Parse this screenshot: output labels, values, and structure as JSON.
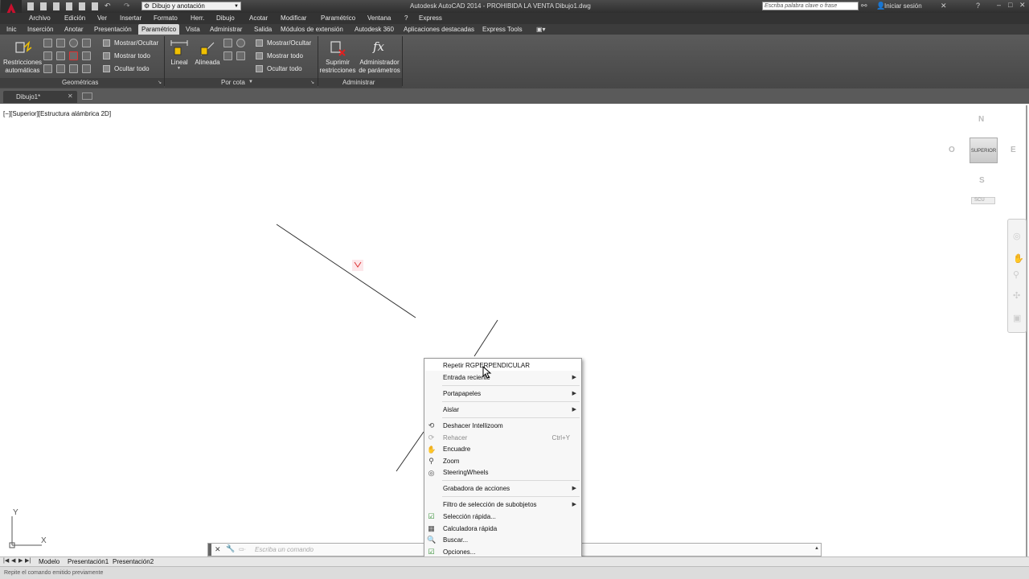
{
  "titlebar": {
    "title": "Autodesk AutoCAD 2014 - PROHIBIDA LA VENTA   Dibujo1.dwg",
    "workspace": "Dibujo y anotación",
    "search_placeholder": "Escriba palabra clave o frase",
    "signin": "Iniciar sesión"
  },
  "menubar": [
    "Archivo",
    "Edición",
    "Ver",
    "Insertar",
    "Formato",
    "Herr.",
    "Dibujo",
    "Acotar",
    "Modificar",
    "Paramétrico",
    "Ventana",
    "?",
    "Express"
  ],
  "ribbon_tabs": [
    "Inic",
    "Inserción",
    "Anotar",
    "Presentación",
    "Paramétrico",
    "Vista",
    "Administrar",
    "Salida",
    "Módulos de extensión",
    "Autodesk 360",
    "Aplicaciones destacadas",
    "Express Tools"
  ],
  "ribbon": {
    "geo": {
      "auto_label_1": "Restricciones",
      "auto_label_2": "automáticas",
      "show_hide": "Mostrar/Ocultar",
      "show_all": "Mostrar todo",
      "hide_all": "Ocultar todo",
      "panel": "Geométricas"
    },
    "dim": {
      "linear": "Lineal",
      "aligned": "Alineada",
      "show_hide": "Mostrar/Ocultar",
      "show_all": "Mostrar todo",
      "hide_all": "Ocultar todo",
      "panel": "Por cota"
    },
    "admin": {
      "delete_1": "Suprimir",
      "delete_2": "restricciones",
      "params_1": "Administrador",
      "params_2": "de parámetros",
      "fx": "fx",
      "panel": "Administrar"
    }
  },
  "doc_tab": "Dibujo1*",
  "viewport_label": "[−][Superior][Estructura alámbrica 2D]",
  "viewcube": {
    "face": "SUPERIOR",
    "n": "N",
    "s": "S",
    "e": "E",
    "w": "O",
    "ucs": "SCU"
  },
  "ucs_icon": {
    "x": "X",
    "y": "Y"
  },
  "context_menu": {
    "items": [
      {
        "label": "Repetir RGPERPENDICULAR",
        "shortcut": "",
        "submenu": false,
        "disabled": false,
        "icon": ""
      },
      {
        "label": "Entrada reciente",
        "shortcut": "",
        "submenu": true,
        "disabled": false,
        "icon": ""
      },
      {
        "label": "Portapapeles",
        "shortcut": "",
        "submenu": true,
        "disabled": false,
        "icon": ""
      },
      {
        "label": "Aislar",
        "shortcut": "",
        "submenu": true,
        "disabled": false,
        "icon": ""
      },
      {
        "label": "Deshacer Intellizoom",
        "shortcut": "",
        "submenu": false,
        "disabled": false,
        "icon": "undo-icon"
      },
      {
        "label": "Rehacer",
        "shortcut": "Ctrl+Y",
        "submenu": false,
        "disabled": true,
        "icon": "redo-icon"
      },
      {
        "label": "Encuadre",
        "shortcut": "",
        "submenu": false,
        "disabled": false,
        "icon": "pan-icon"
      },
      {
        "label": "Zoom",
        "shortcut": "",
        "submenu": false,
        "disabled": false,
        "icon": "zoom-icon"
      },
      {
        "label": "SteeringWheels",
        "shortcut": "",
        "submenu": false,
        "disabled": false,
        "icon": "steeringwheel-icon"
      },
      {
        "label": "Grabadora de acciones",
        "shortcut": "",
        "submenu": true,
        "disabled": false,
        "icon": ""
      },
      {
        "label": "Filtro de selección de subobjetos",
        "shortcut": "",
        "submenu": true,
        "disabled": false,
        "icon": ""
      },
      {
        "label": "Selección rápida...",
        "shortcut": "",
        "submenu": false,
        "disabled": false,
        "icon": "quickselect-icon"
      },
      {
        "label": "Calculadora rápida",
        "shortcut": "",
        "submenu": false,
        "disabled": false,
        "icon": "calculator-icon"
      },
      {
        "label": "Buscar...",
        "shortcut": "",
        "submenu": false,
        "disabled": false,
        "icon": "find-icon"
      },
      {
        "label": "Opciones...",
        "shortcut": "",
        "submenu": false,
        "disabled": false,
        "icon": "options-icon"
      }
    ]
  },
  "command_line": {
    "placeholder": "Escriba un comando"
  },
  "layout_tabs": [
    "Modelo",
    "Presentación1",
    "Presentación2"
  ],
  "status_text": "Repite el comando emitido previamente",
  "colors": {
    "accent_red": "#c8102e",
    "ribbon_bg": "#4f4f4f",
    "menu_bg": "#f7f7f7"
  }
}
